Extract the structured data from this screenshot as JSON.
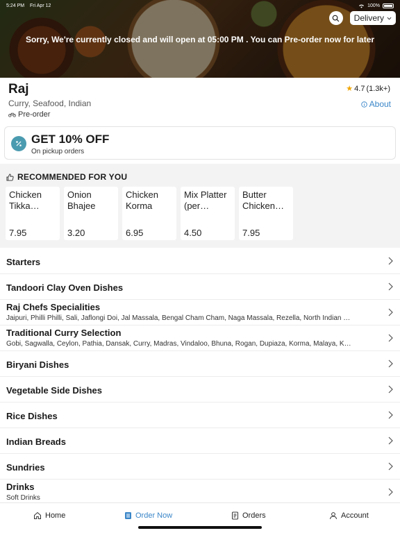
{
  "status_bar": {
    "time": "5:24 PM",
    "date": "Fri Apr 12",
    "battery": "100%"
  },
  "hero": {
    "closed_message": "Sorry, We're currently closed and will open at 05:00 PM . You can Pre-order now for later",
    "delivery_label": "Delivery"
  },
  "restaurant": {
    "name": "Raj",
    "cuisine": "Curry, Seafood, Indian",
    "preorder_label": "Pre-order",
    "rating": "4.7",
    "rating_count": "(1.3k+)",
    "about_label": "About"
  },
  "offer": {
    "title": "GET 10% OFF",
    "subtitle": "On pickup orders"
  },
  "recommended": {
    "heading": "RECOMMENDED FOR YOU",
    "items": [
      {
        "name": "Chicken Tikka Masala",
        "price": "7.95"
      },
      {
        "name": "Onion Bhajee",
        "price": "3.20"
      },
      {
        "name": "Chicken Korma",
        "price": "6.95"
      },
      {
        "name": "Mix Platter (per Person)",
        "price": "4.50"
      },
      {
        "name": "Butter Chicken Tikka",
        "price": "7.95"
      }
    ]
  },
  "categories": [
    {
      "title": "Starters",
      "subtitle": ""
    },
    {
      "title": "Tandoori Clay Oven Dishes",
      "subtitle": ""
    },
    {
      "title": "Raj Chefs Specialities",
      "subtitle": "Jaipuri, Philli Philli, Sali, Jaflongi Doi, Jal Massala, Bengal Cham Cham, Naga Massala, Rezella, North Indian Garlic"
    },
    {
      "title": "Traditional Curry Selection",
      "subtitle": "Gobi, Sagwalla, Ceylon, Pathia, Dansak, Curry, Madras, Vindaloo, Bhuna, Rogan, Dupiaza, Korma, Malaya, Karahi"
    },
    {
      "title": "Biryani Dishes",
      "subtitle": ""
    },
    {
      "title": "Vegetable Side Dishes",
      "subtitle": ""
    },
    {
      "title": "Rice Dishes",
      "subtitle": ""
    },
    {
      "title": "Indian Breads",
      "subtitle": ""
    },
    {
      "title": "Sundries",
      "subtitle": ""
    },
    {
      "title": "Drinks",
      "subtitle": "Soft Drinks"
    }
  ],
  "tabs": [
    {
      "label": "Home",
      "icon": "home-icon"
    },
    {
      "label": "Order Now",
      "icon": "menu-book-icon"
    },
    {
      "label": "Orders",
      "icon": "receipt-icon"
    },
    {
      "label": "Account",
      "icon": "person-icon"
    }
  ],
  "colors": {
    "accent": "#3a86c8",
    "offer_badge": "#4b9bb0",
    "star": "#f0a500"
  }
}
